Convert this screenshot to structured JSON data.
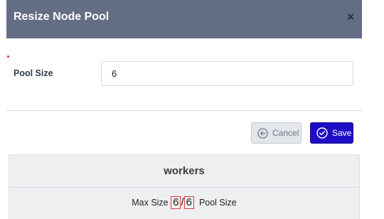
{
  "modal": {
    "title": "Resize Node Pool",
    "close_glyph": "×"
  },
  "form": {
    "pool_size_label": "Pool Size",
    "pool_size_value": "6"
  },
  "buttons": {
    "cancel_label": "Cancel",
    "cancel_icon": "arrow-left-circle-icon",
    "save_label": "Save",
    "save_icon": "check-circle-icon"
  },
  "summary": {
    "title": "workers",
    "max_size_label": "Max Size",
    "max_size_value": "6",
    "separator": "/",
    "current_value": "6",
    "pool_size_label": "Pool Size"
  },
  "colors": {
    "header_bg": "#636e85",
    "save_bg": "#1d0ec6",
    "required_marker": "#e0312c",
    "highlight_border": "#e13b3b"
  }
}
